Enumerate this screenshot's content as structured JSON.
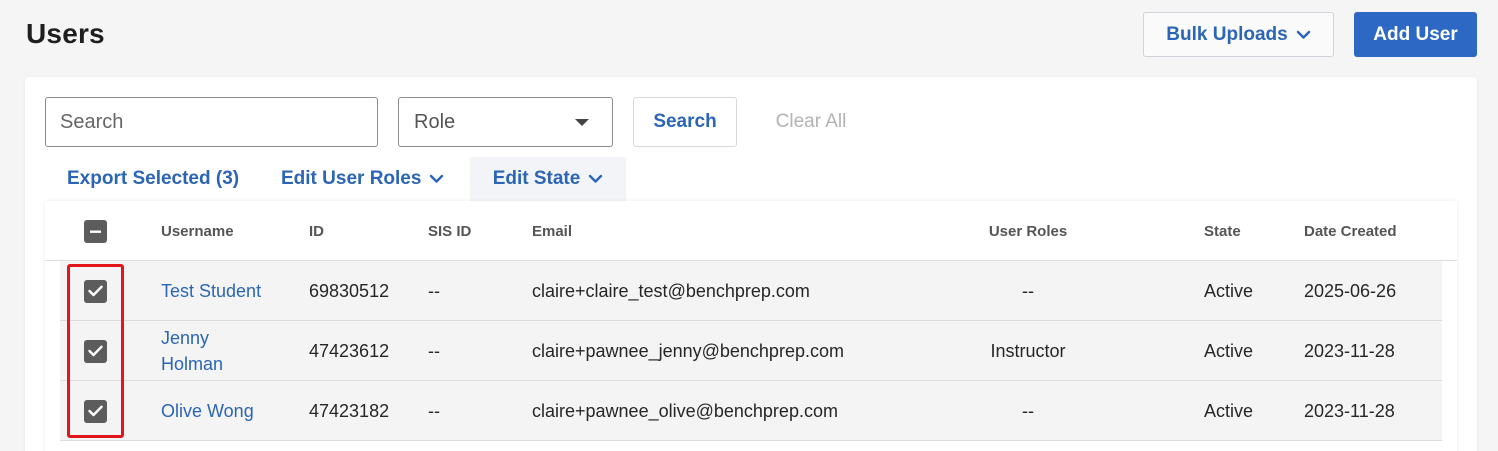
{
  "header": {
    "title": "Users",
    "bulk_uploads_label": "Bulk Uploads",
    "add_user_label": "Add User"
  },
  "filters": {
    "search_placeholder": "Search",
    "role_placeholder": "Role",
    "search_button": "Search",
    "clear_all": "Clear All"
  },
  "actions": {
    "export_selected": "Export Selected (3)",
    "edit_user_roles": "Edit User Roles",
    "edit_state": "Edit State"
  },
  "table": {
    "columns": [
      "Username",
      "ID",
      "SIS ID",
      "Email",
      "User Roles",
      "State",
      "Date Created"
    ],
    "rows": [
      {
        "username": "Test Student",
        "id": "69830512",
        "sis_id": "--",
        "email": "claire+claire_test@benchprep.com",
        "roles": "--",
        "state": "Active",
        "date": "2025-06-26",
        "checked": true
      },
      {
        "username": "Jenny Holman",
        "id": "47423612",
        "sis_id": "--",
        "email": "claire+pawnee_jenny@benchprep.com",
        "roles": "Instructor",
        "state": "Active",
        "date": "2023-11-28",
        "checked": true
      },
      {
        "username": "Olive Wong",
        "id": "47423182",
        "sis_id": "--",
        "email": "claire+pawnee_olive@benchprep.com",
        "roles": "--",
        "state": "Active",
        "date": "2023-11-28",
        "checked": true
      }
    ]
  },
  "colors": {
    "accent": "#2b65b3",
    "primary_button": "#2d68c4",
    "highlight": "#e3141b"
  }
}
